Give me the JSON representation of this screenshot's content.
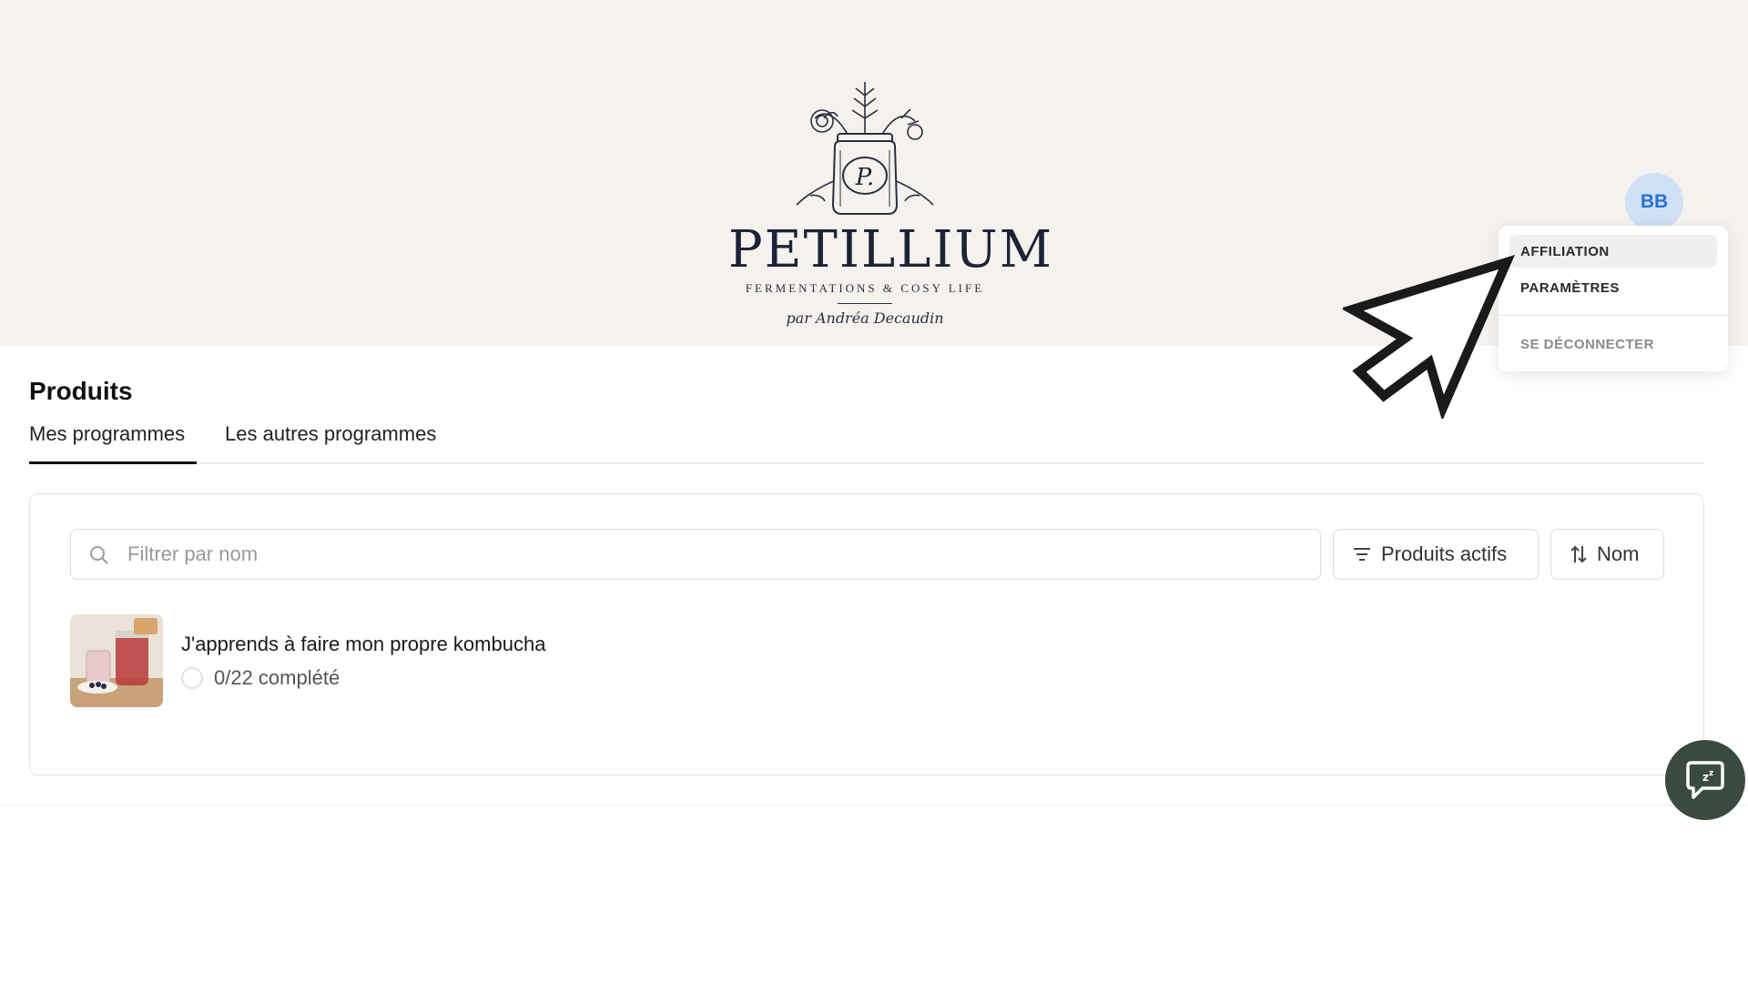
{
  "brand": {
    "name": "PETILLIUM",
    "tagline": "FERMENTATIONS & COSY LIFE",
    "signature": "par Andréa Decaudin",
    "logo_icon": "jar-with-herbs-icon"
  },
  "user": {
    "initials": "BB",
    "avatar_bg": "#cfe1f7",
    "avatar_fg": "#2b6fd6"
  },
  "user_menu": {
    "items": [
      {
        "label": "AFFILIATION",
        "active": true
      },
      {
        "label": "PARAMÈTRES",
        "active": false
      }
    ],
    "logout_label": "SE DÉCONNECTER"
  },
  "page": {
    "title": "Produits",
    "tabs": [
      {
        "label": "Mes programmes",
        "active": true
      },
      {
        "label": "Les autres programmes",
        "active": false
      }
    ]
  },
  "toolbar": {
    "search_placeholder": "Filtrer par nom",
    "search_value": "",
    "filter_label": "Produits actifs",
    "sort_label": "Nom"
  },
  "products": [
    {
      "title": "J'apprends à faire mon propre kombucha",
      "status": "0/22 complété",
      "progress": 0,
      "thumbnail_icon": "kombucha-jar-photo"
    }
  ],
  "colors": {
    "banner_bg": "#f5f2ee",
    "chat_bg": "#3a4a3f",
    "text_primary": "#111111"
  }
}
